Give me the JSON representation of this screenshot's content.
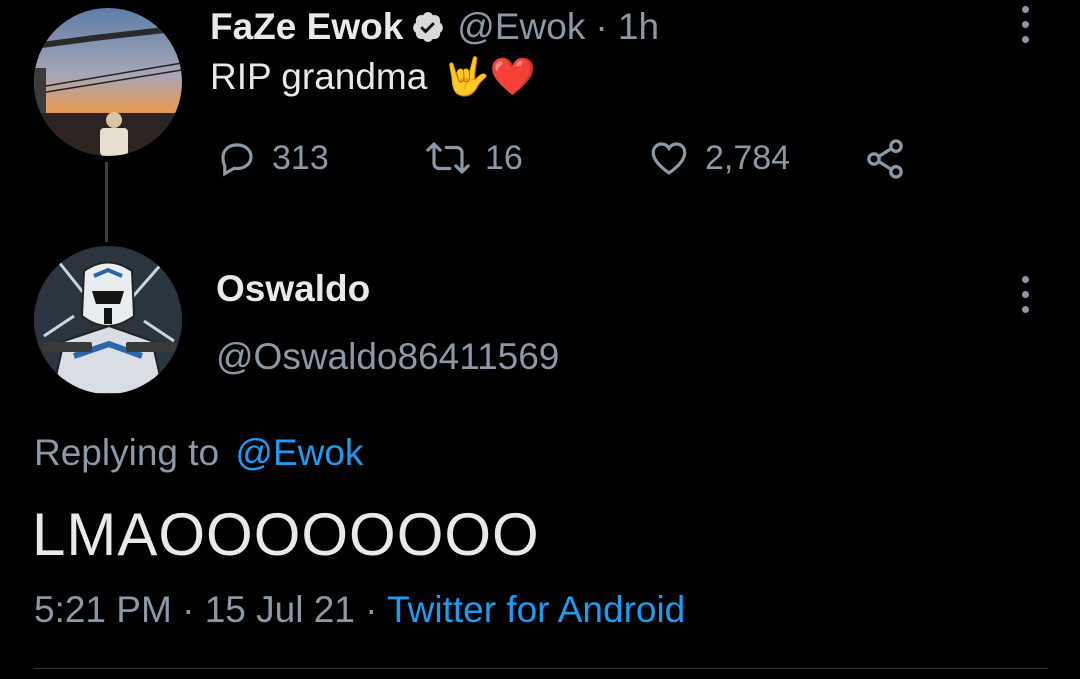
{
  "original_tweet": {
    "display_name": "FaZe Ewok",
    "handle": "@Ewok",
    "time": "· 1h",
    "text": "RIP grandma",
    "emoji": "🤟❤️",
    "avatar_icon": "sunset-photo",
    "actions": {
      "replies": "313",
      "retweets": "16",
      "likes": "2,784"
    }
  },
  "reply_tweet": {
    "display_name": "Oswaldo",
    "handle": "@Oswaldo86411569",
    "avatar_icon": "clone-trooper-art",
    "replying_prefix": "Replying to",
    "replying_to": "@Ewok",
    "text": "LMAOOOOOOOO",
    "timestamp": "5:21 PM",
    "date": "15 Jul 21",
    "source": "Twitter for Android"
  },
  "colors": {
    "background": "#000000",
    "muted": "#8b98a5",
    "accent": "#1d9bf0",
    "heart_red": "#e0245e"
  }
}
